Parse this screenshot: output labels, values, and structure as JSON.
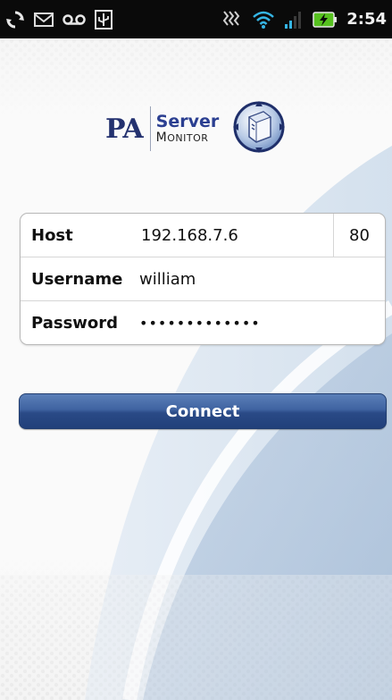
{
  "status_bar": {
    "time": "2:54",
    "icons": [
      "sync-icon",
      "gmail-icon",
      "voicemail-icon",
      "usb-debug-icon",
      "vibrate-icon",
      "wifi-icon",
      "signal-icon",
      "battery-charging-icon"
    ]
  },
  "logo": {
    "pa": "PA",
    "server": "Server",
    "monitor_first": "M",
    "monitor_rest": "ONITOR"
  },
  "form": {
    "host": {
      "label": "Host",
      "value": "192.168.7.6",
      "port": "80"
    },
    "username": {
      "label": "Username",
      "value": "william"
    },
    "password": {
      "label": "Password",
      "value": "•••••••••••••"
    }
  },
  "actions": {
    "connect_label": "Connect"
  },
  "colors": {
    "button_top": "#5b7fb8",
    "button_bottom": "#21407a",
    "logo_blue": "#23316f"
  }
}
